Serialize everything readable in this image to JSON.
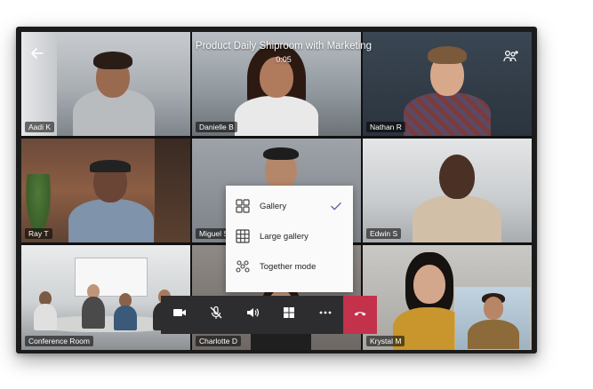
{
  "meeting": {
    "title": "Product Daily Shiproom with Marketing",
    "timer": "0:05"
  },
  "participants": [
    {
      "name": "Aadi K"
    },
    {
      "name": "Danielle B"
    },
    {
      "name": "Nathan R"
    },
    {
      "name": "Ray T"
    },
    {
      "name": "Miguel S"
    },
    {
      "name": "Edwin S"
    },
    {
      "name": "Conference Room"
    },
    {
      "name": "Charlotte D"
    },
    {
      "name": "Krystal M"
    }
  ],
  "layout_menu": {
    "items": [
      {
        "label": "Gallery",
        "icon": "gallery-icon",
        "selected": true
      },
      {
        "label": "Large gallery",
        "icon": "large-gallery-icon",
        "selected": false
      },
      {
        "label": "Together mode",
        "icon": "together-mode-icon",
        "selected": false
      }
    ]
  },
  "controls": [
    {
      "icon": "camera-icon"
    },
    {
      "icon": "mic-muted-icon"
    },
    {
      "icon": "speaker-icon"
    },
    {
      "icon": "layout-icon"
    },
    {
      "icon": "more-icon"
    },
    {
      "icon": "hang-up-icon"
    }
  ],
  "colors": {
    "hangup": "#c4314b",
    "control_bar": "#2d2d2f",
    "menu_bg": "#fafafa",
    "accent": "#6264a7"
  }
}
